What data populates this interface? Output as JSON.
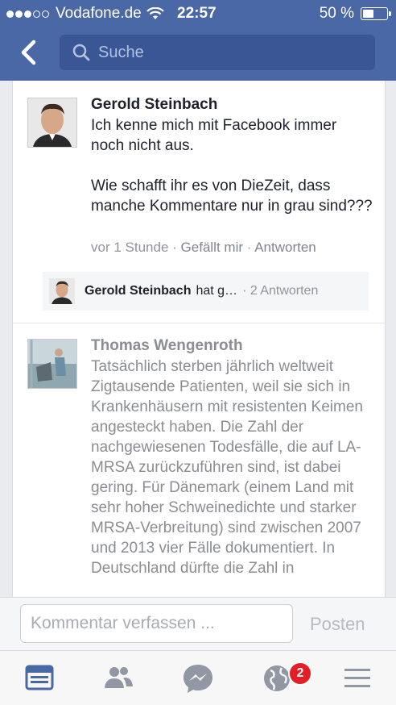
{
  "status_bar": {
    "carrier": "Vodafone.de",
    "time": "22:57",
    "battery": "50 %",
    "battery_level": 0.5
  },
  "nav": {
    "search_placeholder": "Suche"
  },
  "comments": [
    {
      "author": "Gerold Steinbach",
      "text": "Ich kenne mich mit Facebook immer noch nicht aus.\n\nWie schafft ihr es von DieZeit, dass manche Kommentare nur in grau sind???",
      "time": "vor 1 Stunde",
      "like": "Gefällt mir",
      "reply": "Antworten",
      "separator": "·",
      "reply_preview": {
        "author": "Gerold Steinbach",
        "snippet": "hat g…",
        "count": "· 2 Antworten"
      }
    },
    {
      "author": "Thomas Wengenroth",
      "text": "Tatsächlich sterben jährlich weltweit Zigtausende Patienten, weil sie sich in Krankenhäusern mit resistenten Keimen angesteckt haben. Die Zahl der nachgewiesenen Todesfälle, die auf LA-MRSA zurückzuführen sind, ist dabei gering. Für Dänemark (einem Land mit sehr hoher Schweinedichte und starker MRSA-Verbreitung) sind zwischen 2007 und 2013 vier Fälle dokumentiert. In Deutschland dürfte die Zahl in"
    }
  ],
  "composer": {
    "placeholder": "Kommentar verfassen ...",
    "post_label": "Posten"
  },
  "tabbar": {
    "notifications_badge": "2"
  },
  "colors": {
    "header_bg": "#4a67a6",
    "search_bg": "#3b5695",
    "active_tab": "#4a67a6",
    "badge": "#e41e25"
  }
}
